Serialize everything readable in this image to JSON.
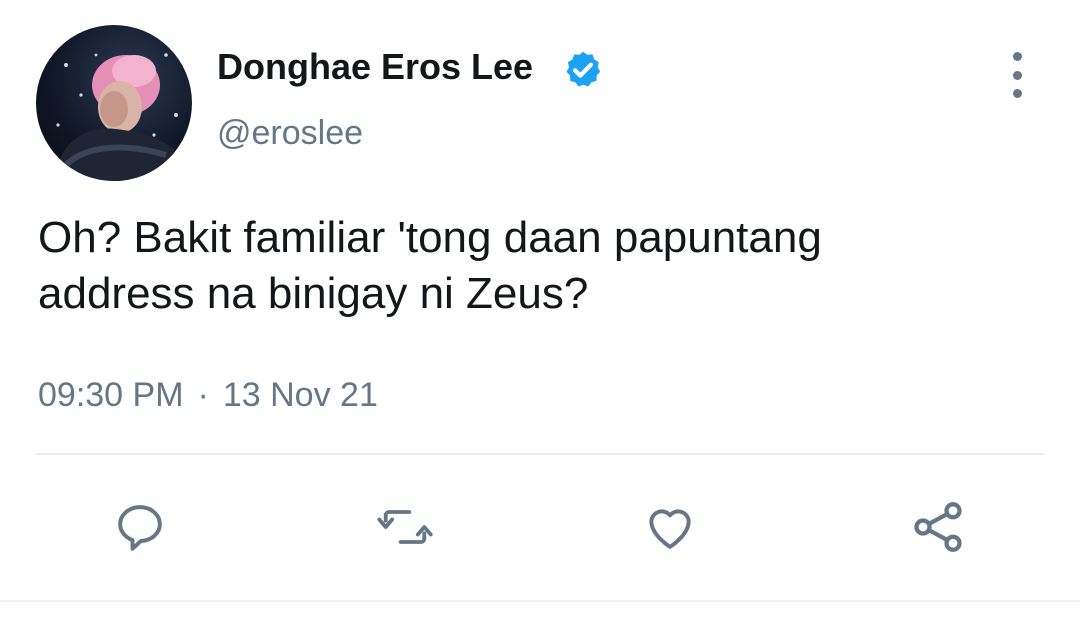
{
  "author": {
    "display_name": "Donghae Eros Lee",
    "handle": "@eroslee",
    "verified": true,
    "avatar_icon": "profile-photo"
  },
  "tweet": {
    "text_lines": [
      "Oh? Bakit familiar 'tong daan papuntang",
      "address na binigay ni Zeus?"
    ],
    "time": "09:30 PM",
    "separator": "·",
    "date": "13 Nov 21"
  },
  "actions": [
    {
      "icon": "reply-icon"
    },
    {
      "icon": "retweet-icon"
    },
    {
      "icon": "like-icon"
    },
    {
      "icon": "share-icon"
    }
  ],
  "colors": {
    "text": "#14171a",
    "secondary": "#657786",
    "verified": "#1da1f2",
    "divider": "#e6ecf0"
  }
}
